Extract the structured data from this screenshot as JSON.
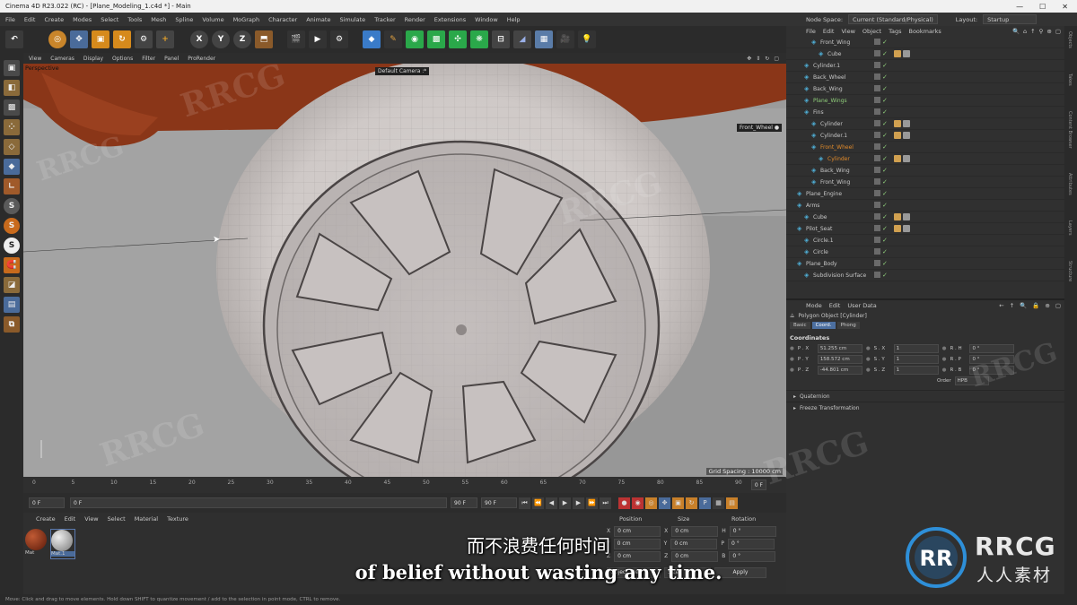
{
  "window": {
    "title": "Cinema 4D R23.022 (RC) - [Plane_Modeling_1.c4d *] - Main",
    "controls": [
      "—",
      "☐",
      "✕"
    ]
  },
  "menubar": {
    "items": [
      "File",
      "Edit",
      "Create",
      "Modes",
      "Select",
      "Tools",
      "Mesh",
      "Spline",
      "Volume",
      "MoGraph",
      "Character",
      "Animate",
      "Simulate",
      "Tracker",
      "Render",
      "Extensions",
      "Window",
      "Help"
    ]
  },
  "nodespace": {
    "label": "Node Space:",
    "value": "Current (Standard/Physical)",
    "layout_label": "Layout:",
    "layout_value": "Startup"
  },
  "toolbar": {
    "axes": [
      "X",
      "Y",
      "Z"
    ]
  },
  "viewport": {
    "menu": [
      "View",
      "Cameras",
      "Display",
      "Options",
      "Filter",
      "Panel",
      "ProRender"
    ],
    "name": "Perspective",
    "camera_tag": "Default Camera :*",
    "object_tag": "Front_Wheel ●",
    "grid_spacing": "Grid Spacing : 10000 cm"
  },
  "timeline": {
    "ticks": [
      "0",
      "5",
      "10",
      "15",
      "20",
      "25",
      "30",
      "35",
      "40",
      "45",
      "50",
      "55",
      "60",
      "65",
      "70",
      "75",
      "80",
      "85",
      "90"
    ],
    "current_frame": "0 F"
  },
  "transport": {
    "start": "0 F",
    "min": "0 F",
    "max": "90 F",
    "end": "90 F"
  },
  "materials": {
    "menu": [
      "Create",
      "Edit",
      "View",
      "Select",
      "Material",
      "Texture"
    ],
    "items": [
      {
        "name": "Mat",
        "color": "#7a2a14"
      },
      {
        "name": "Mat.1",
        "color": "#b5b5b5"
      }
    ]
  },
  "coords": {
    "headers": [
      "Position",
      "Size",
      "Rotation"
    ],
    "rows": [
      {
        "axis": "X",
        "pos": "0 cm",
        "size_axis": "X",
        "size": "0 cm",
        "rot_axis": "H",
        "rot": "0 °"
      },
      {
        "axis": "Y",
        "pos": "0 cm",
        "size_axis": "Y",
        "size": "0 cm",
        "rot_axis": "P",
        "rot": "0 °"
      },
      {
        "axis": "Z",
        "pos": "0 cm",
        "size_axis": "Z",
        "size": "0 cm",
        "rot_axis": "B",
        "rot": "0 °"
      }
    ],
    "mode_object": "Object (Rel)",
    "mode_size": "Size",
    "apply": "Apply"
  },
  "object_manager": {
    "menu": [
      "File",
      "Edit",
      "View",
      "Object",
      "Tags",
      "Bookmarks"
    ],
    "rows": [
      {
        "name": "Front_Wing",
        "indent": 2,
        "color": "#c8c8c8"
      },
      {
        "name": "Cube",
        "indent": 3,
        "color": "#c8c8c8"
      },
      {
        "name": "Cylinder.1",
        "indent": 1,
        "color": "#c8c8c8"
      },
      {
        "name": "Back_Wheel",
        "indent": 1,
        "color": "#c8c8c8"
      },
      {
        "name": "Back_Wing",
        "indent": 1,
        "color": "#c8c8c8"
      },
      {
        "name": "Plane_Wings",
        "indent": 1,
        "color": "#8fce7a"
      },
      {
        "name": "Fins",
        "indent": 1,
        "color": "#c8c8c8"
      },
      {
        "name": "Cylinder",
        "indent": 2,
        "color": "#c8c8c8"
      },
      {
        "name": "Cylinder.1",
        "indent": 2,
        "color": "#c8c8c8"
      },
      {
        "name": "Front_Wheel",
        "indent": 2,
        "color": "#e08a2a"
      },
      {
        "name": "Cylinder",
        "indent": 3,
        "color": "#e08a2a"
      },
      {
        "name": "Back_Wing",
        "indent": 2,
        "color": "#c8c8c8"
      },
      {
        "name": "Front_Wing",
        "indent": 2,
        "color": "#c8c8c8"
      },
      {
        "name": "Plane_Engine",
        "indent": 0,
        "color": "#c8c8c8"
      },
      {
        "name": "Arms",
        "indent": 0,
        "color": "#c8c8c8"
      },
      {
        "name": "Cube",
        "indent": 1,
        "color": "#c8c8c8"
      },
      {
        "name": "Pilot_Seat",
        "indent": 0,
        "color": "#c8c8c8"
      },
      {
        "name": "Circle.1",
        "indent": 1,
        "color": "#c8c8c8"
      },
      {
        "name": "Circle",
        "indent": 1,
        "color": "#c8c8c8"
      },
      {
        "name": "Plane_Body",
        "indent": 0,
        "color": "#c8c8c8"
      },
      {
        "name": "Subdivision Surface",
        "indent": 1,
        "color": "#c8c8c8"
      }
    ]
  },
  "attributes": {
    "menu": [
      "Mode",
      "Edit",
      "User Data"
    ],
    "object_title": "Polygon Object [Cylinder]",
    "tabs": [
      "Basic",
      "Coord.",
      "Phong"
    ],
    "active_tab": "Coord.",
    "section": "Coordinates",
    "rows": [
      {
        "a": "P . X",
        "av": "51.255 cm",
        "b": "S . X",
        "bv": "1",
        "c": "R . H",
        "cv": "0 °"
      },
      {
        "a": "P . Y",
        "av": "158.572 cm",
        "b": "S . Y",
        "bv": "1",
        "c": "R . P",
        "cv": "0 °"
      },
      {
        "a": "P . Z",
        "av": "-44.801 cm",
        "b": "S . Z",
        "bv": "1",
        "c": "R . B",
        "cv": "0 °"
      }
    ],
    "order_label": "Order",
    "order_value": "HPB",
    "groups": [
      "Quaternion",
      "Freeze Transformation"
    ]
  },
  "right_tabs": [
    "Objects",
    "Takes",
    "Content Browser",
    "Attributes",
    "Layers",
    "Structure"
  ],
  "statusbar": "Move: Click and drag to move elements. Hold down SHIFT to quantize movement / add to the selection in point mode, CTRL to remove.",
  "subtitles": {
    "cn": "而不浪费任何时间",
    "en": "of belief without wasting any time."
  },
  "logo": {
    "main": "RRCG",
    "sub": "人人素材"
  },
  "watermark": "RRCG"
}
